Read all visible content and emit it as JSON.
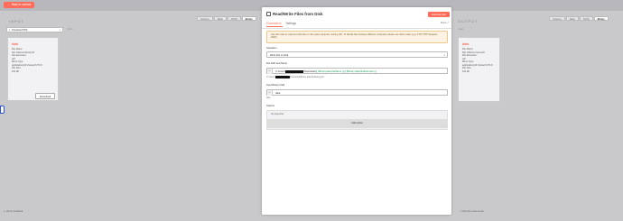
{
  "topbar": {
    "back_label": "Back to canvas",
    "back_icon": "arrow-left-icon"
  },
  "input": {
    "label": "INPUT",
    "tabs": [
      "Schema",
      "Table",
      "JSON",
      "Binary"
    ],
    "active_tab": "Binary",
    "select_value": "Download PDF",
    "count": "1 item",
    "card": {
      "title": "data",
      "rows": [
        "File Name:",
        "File: Macron Boost.pdf",
        "File Extension:",
        "pdf",
        "Mime Type:",
        "application/pdf;charset=UTF-8",
        "File Size:",
        "163 kB"
      ]
    },
    "download_label": "Download"
  },
  "output": {
    "label": "OUTPUT",
    "tabs": [
      "Schema",
      "Table",
      "JSON",
      "Binary"
    ],
    "active_tab": "Binary",
    "count": "1 item",
    "card": {
      "title": "data",
      "rows": [
        "File Name:",
        "File: Macron boost.pdf",
        "File Extension:",
        "pdf",
        "Mime Type:",
        "application/pdf;charset=UTF-8",
        "File Size:",
        "163 kB"
      ]
    }
  },
  "modal": {
    "title": "Read/Write Files from Disk",
    "execute_label": "Execute step",
    "tabs": [
      "Parameters",
      "Settings"
    ],
    "docs_label": "Docs",
    "notice": "Use this node to read and write files on the same computer running n8n. To handle files between different computers please use other nodes (e.g. FTP, HTTP Request, AWS).",
    "operation_label": "Operation",
    "operation_value": "Write File to Disk",
    "filepath_label": "File Path and Name",
    "filepath_prefix": "C:\\Users\\",
    "filepath_mid": "\\Download\\",
    "filepath_expr": "{{ $binary.data.fileName }}.{{ $binary.data.fileExtension }}",
    "filepath_hint_prefix": "C:\\Users\\",
    "filepath_hint_suffix": "\\Download\\[Binary data:fileName].pdf",
    "binary_label": "Input Binary Field",
    "binary_value": "data",
    "binary_hint": "data",
    "options_label": "Options",
    "no_properties": "No properties",
    "add_option": "Add option"
  },
  "bottom": {
    "left_label": "Wrote feedback",
    "right_label": "I wish this node would..."
  },
  "colors": {
    "accent": "#ff6d5a",
    "background": "#c9c9cc",
    "expression": "#1a9b5b"
  }
}
